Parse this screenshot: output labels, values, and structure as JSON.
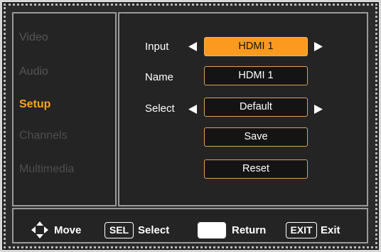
{
  "sidebar": {
    "items": [
      {
        "label": "Video"
      },
      {
        "label": "Audio"
      },
      {
        "label": "Setup"
      },
      {
        "label": "Channels"
      },
      {
        "label": "Multimedia"
      }
    ]
  },
  "setup": {
    "input": {
      "label": "Input",
      "value": "HDMI 1"
    },
    "name": {
      "label": "Name",
      "value": "HDMI 1"
    },
    "select": {
      "label": "Select",
      "value": "Default"
    },
    "save_label": "Save",
    "reset_label": "Reset"
  },
  "footer": {
    "move_label": "Move",
    "sel_key": "SEL",
    "select_label": "Select",
    "return_label": "Return",
    "exit_key": "EXIT",
    "exit_label": "Exit"
  },
  "colors": {
    "accent": "#f7a51f",
    "selected_fill": "#fb9a1f",
    "box_border": "#d7a45a",
    "background": "#242424"
  },
  "icons": [
    "arrow-left-icon",
    "arrow-right-icon",
    "dpad-move-icon",
    "return-key-icon"
  ]
}
